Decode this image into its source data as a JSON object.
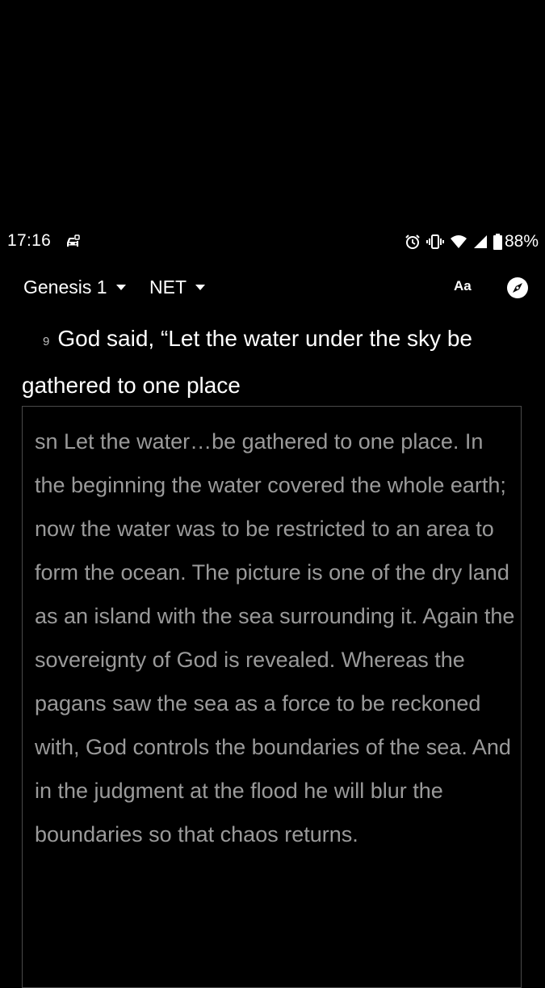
{
  "status_bar": {
    "time": "17:16",
    "battery": "88%",
    "icons": [
      "car-icon",
      "alarm-icon",
      "vibrate-icon",
      "wifi-icon",
      "signal-icon",
      "battery-icon"
    ]
  },
  "toolbar": {
    "book_chapter": "Genesis 1",
    "version": "NET",
    "font_label": "Aa",
    "icons": [
      "chevron-down-icon",
      "compass-icon"
    ]
  },
  "verse": {
    "number": "9",
    "text": "God said, “Let the water under the sky be gathered to one place"
  },
  "note": {
    "text": "sn Let the water…be gathered to one place. In the beginning the water covered the whole earth; now the water was to be restricted to an area to form the ocean. The picture is one of the dry land as an island with the sea surrounding it. Again the sovereignty of God is revealed. Whereas the pagans saw the sea as a force to be reckoned with, God controls the boundaries of the sea. And in the judgment at the flood he will blur the boundaries so that chaos returns."
  },
  "colors": {
    "background": "#000000",
    "primary_text": "#ffffff",
    "note_text": "#9a9a9a",
    "note_border": "#4a4a4a"
  }
}
